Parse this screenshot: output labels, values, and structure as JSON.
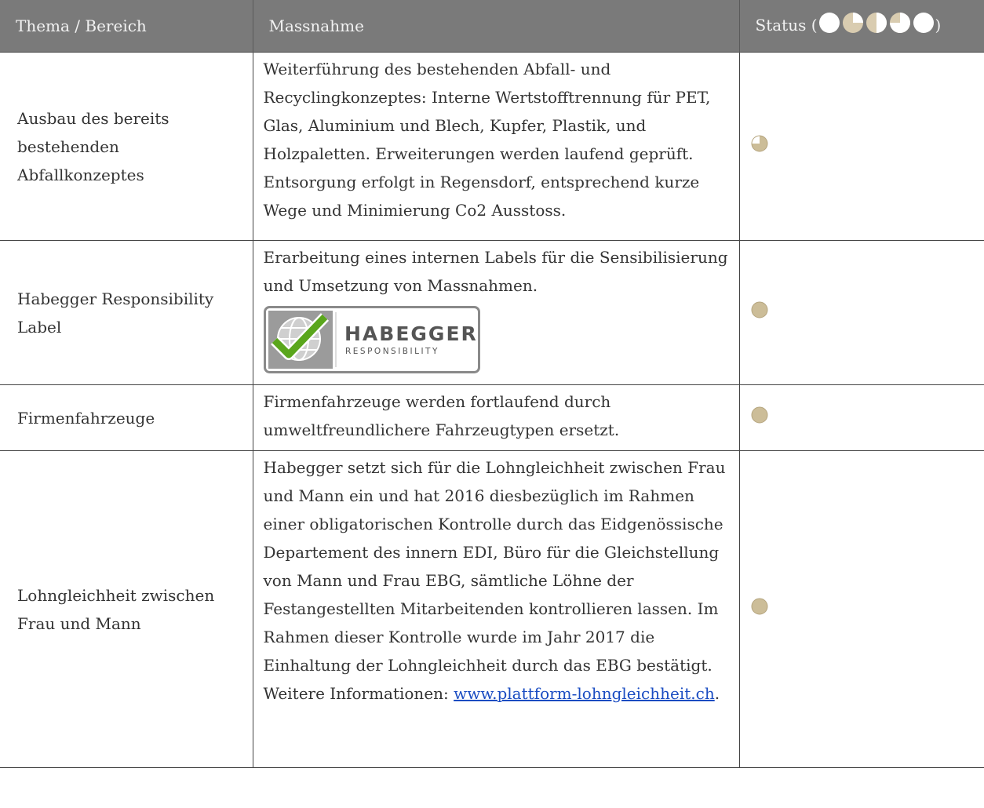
{
  "header": {
    "col1": "Thema / Bereich",
    "col2": "Massnahme",
    "status_prefix": "Status (",
    "status_suffix": ")"
  },
  "colors": {
    "header_bg": "#7a7a7a",
    "status_dot": "#d9ccb0",
    "status_dot_fill": "#ccbd98",
    "link": "#1a4cc2"
  },
  "legend": [
    {
      "level": 0,
      "icon": "status-empty-circle"
    },
    {
      "level": 0.25,
      "icon": "status-quarter-circle"
    },
    {
      "level": 0.5,
      "icon": "status-half-circle"
    },
    {
      "level": 0.75,
      "icon": "status-three-quarter-circle"
    },
    {
      "level": 1,
      "icon": "status-full-circle"
    }
  ],
  "rows": [
    {
      "thema": "Ausbau des bereits bestehenden Abfallkonzeptes",
      "massnahme": "Weiterführung des bestehenden Abfall- und Recyclingkonzeptes: Interne Wertstofftrennung für PET, Glas, Aluminium und Blech, Kupfer, Plastik, und Holzpaletten. Erweiterungen werden laufend geprüft. Entsorgung erfolgt in Regensdorf, entsprechend kurze Wege und Minimierung Co2 Ausstoss.",
      "status": 0.75
    },
    {
      "thema": "Habegger Responsibility Label",
      "massnahme": "Erarbeitung eines internen Labels für die Sensibilisierung und Umsetzung von Massnahmen.",
      "logo": {
        "line1": "HABEGGER",
        "line2": "RESPONSIBILITY",
        "icon": "globe-checkmark-icon"
      },
      "status": 1
    },
    {
      "thema": "Firmenfahrzeuge",
      "massnahme": "Firmenfahrzeuge werden fortlaufend durch umweltfreundlichere Fahrzeugtypen ersetzt.",
      "status": 1
    },
    {
      "thema": "Lohngleichheit zwischen Frau und Mann",
      "massnahme": "Habegger setzt sich für die Lohngleichheit zwischen Frau und Mann ein und hat 2016 diesbezüglich im Rahmen einer obligatorischen Kontrolle durch das Eidgenössische Departement des innern EDI, Büro für die Gleichstellung von Mann und Frau EBG, sämtliche Löhne der Festangestellten Mitarbeitenden kontrollieren lassen. Im Rahmen dieser Kontrolle wurde im Jahr 2017 die Einhaltung der Lohngleichheit durch das EBG bestätigt.",
      "info_prefix": "Weitere Informationen: ",
      "info_link": "www.plattform-lohngleichheit.ch",
      "info_suffix": ".",
      "status": 1
    }
  ]
}
